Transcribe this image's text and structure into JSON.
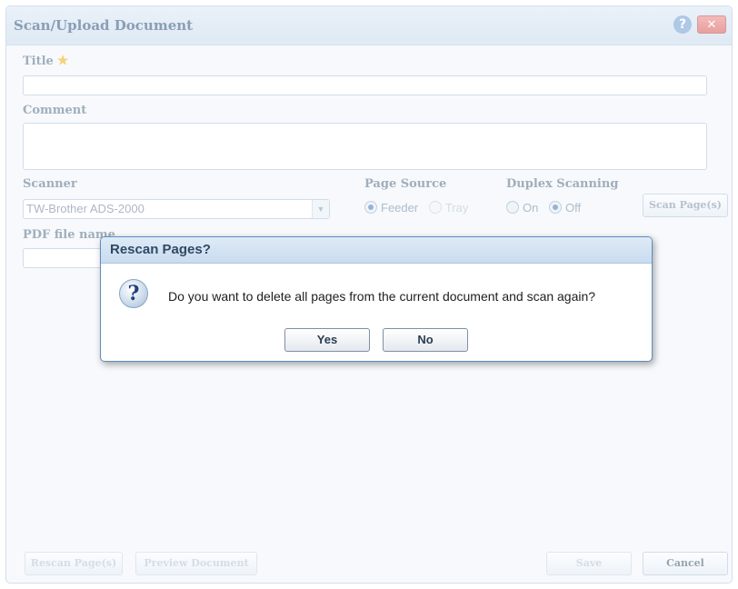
{
  "window": {
    "title": "Scan/Upload Document",
    "help_icon": "?",
    "close_icon": "✕"
  },
  "form": {
    "title_label": "Title",
    "title_required_icon": "★",
    "title_value": "",
    "comment_label": "Comment",
    "comment_value": "",
    "scanner_label": "Scanner",
    "scanner_value": "TW-Brother ADS-2000",
    "page_source_label": "Page Source",
    "page_source_options": [
      "Feeder",
      "Tray"
    ],
    "page_source_selected": "Feeder",
    "duplex_label": "Duplex Scanning",
    "duplex_options": [
      "On",
      "Off"
    ],
    "duplex_selected": "Off",
    "scan_button": "Scan Page(s)",
    "pdf_label": "PDF file name",
    "pdf_value": ""
  },
  "footer": {
    "rescan_button": "Rescan Page(s)",
    "preview_button": "Preview Document",
    "save_button": "Save",
    "cancel_button": "Cancel"
  },
  "dialog": {
    "title": "Rescan Pages?",
    "icon": "?",
    "message": "Do you want to delete all pages from the current document and scan again?",
    "yes_button": "Yes",
    "no_button": "No"
  }
}
